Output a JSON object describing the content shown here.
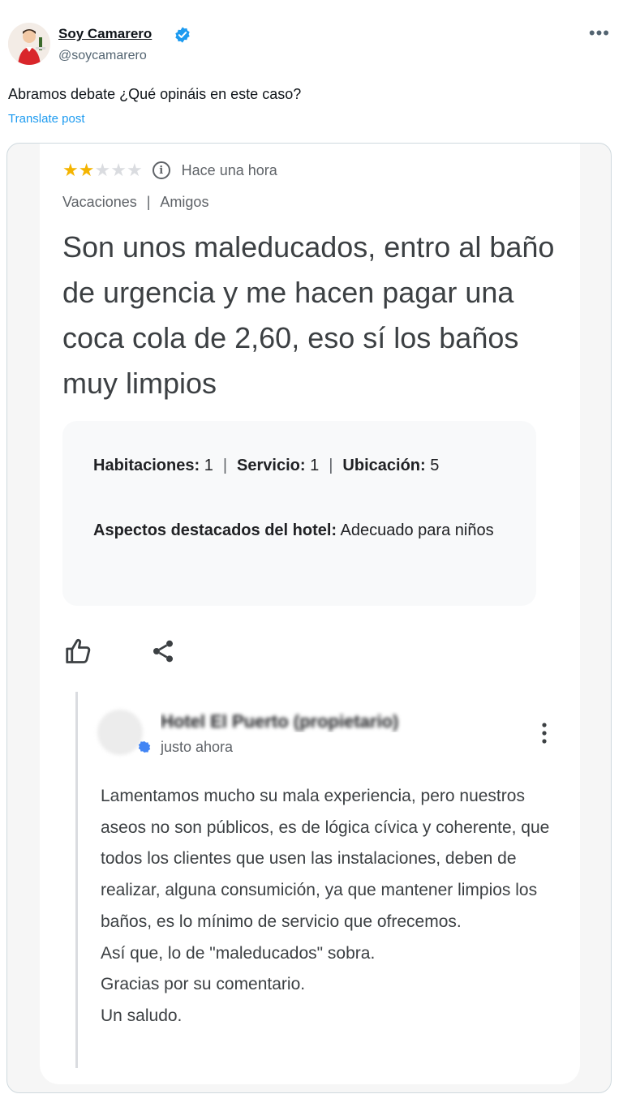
{
  "tweet": {
    "display_name": "Soy Camarero",
    "handle": "@soycamarero",
    "verified": true,
    "text": "Abramos debate ¿Qué opináis en este caso?",
    "translate_label": "Translate post",
    "more_icon": "more-horizontal-icon"
  },
  "review": {
    "rating": 2,
    "rating_max": 5,
    "time_ago": "Hace una hora",
    "tags": [
      "Vacaciones",
      "Amigos"
    ],
    "body": "Son unos maleducados, entro al baño de urgencia y me hacen pagar una coca cola de 2,60, eso sí los baños muy limpios",
    "sub_ratings": [
      {
        "label": "Habitaciones:",
        "value": "1"
      },
      {
        "label": "Servicio:",
        "value": "1"
      },
      {
        "label": "Ubicación:",
        "value": "5"
      }
    ],
    "highlights_label": "Aspectos destacados del hotel:",
    "highlights_value": "Adecuado para niños",
    "like_icon": "thumbs-up-icon",
    "share_icon": "share-icon"
  },
  "reply": {
    "owner_name": "Hotel El Puerto (propietario)",
    "time": "justo ahora",
    "text": "Lamentamos mucho su mala experiencia, pero nuestros aseos no son públicos, es de lógica cívica y coherente, que todos los clientes que usen las instalaciones, deben de realizar, alguna consumición, ya que mantener limpios los baños, es lo mínimo de servicio que ofrecemos.\nAsí que, lo de \"maleducados\" sobra.\nGracias por su comentario.\nUn saludo."
  },
  "colors": {
    "star_on": "#f4b400",
    "star_off": "#dadce0",
    "link": "#1d9bf0",
    "verified": "#1d9bf0"
  }
}
